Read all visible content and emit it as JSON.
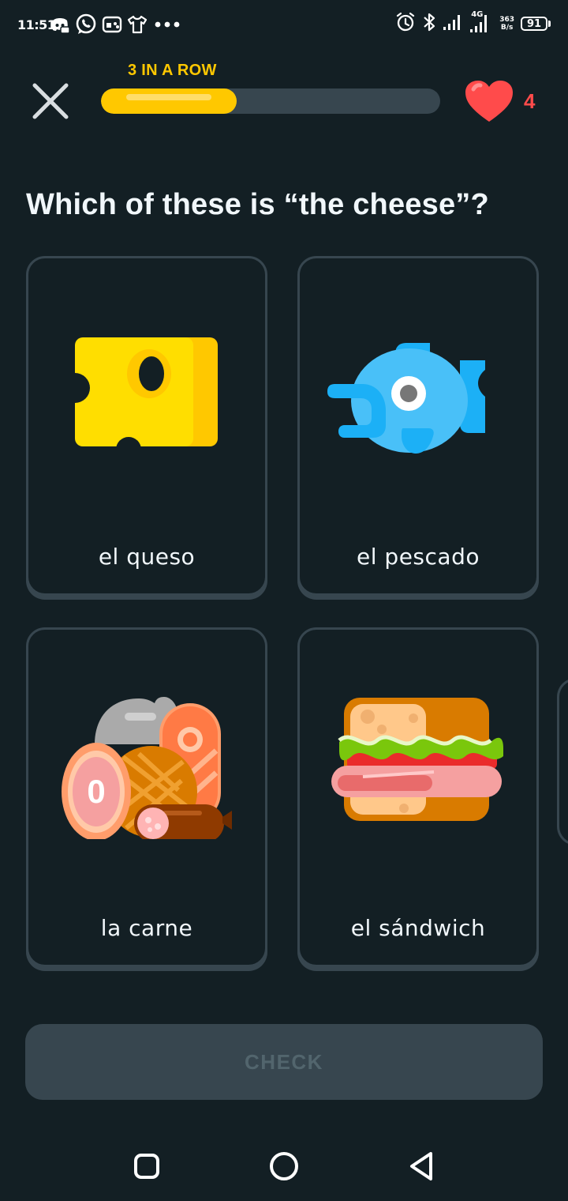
{
  "status_bar": {
    "time": "11:51",
    "network": "4G",
    "speed": "363",
    "speed_unit": "B/s",
    "battery": "91",
    "left_icons": [
      "discord-icon",
      "whatsapp-icon",
      "gamepad-icon",
      "shirt-icon",
      "more-dots-icon"
    ],
    "right_icons": [
      "alarm-icon",
      "bluetooth-icon",
      "signal-icon",
      "signal-4g-icon"
    ]
  },
  "header": {
    "streak_label": "3 IN A ROW",
    "progress_fraction": 0.4,
    "hearts": "4"
  },
  "question": "Which of these is “the cheese”?",
  "choices": [
    {
      "label": "el queso",
      "icon": "cheese-icon"
    },
    {
      "label": "el pescado",
      "icon": "fish-icon"
    },
    {
      "label": "la carne",
      "icon": "meat-icon"
    },
    {
      "label": "el sándwich",
      "icon": "sandwich-icon"
    }
  ],
  "check_button": "CHECK",
  "colors": {
    "background": "#131f24",
    "card_border": "#37464f",
    "streak": "#ffc800",
    "heart": "#ff4b4b",
    "button_disabled": "#37464f",
    "button_text_disabled": "#52656d"
  }
}
